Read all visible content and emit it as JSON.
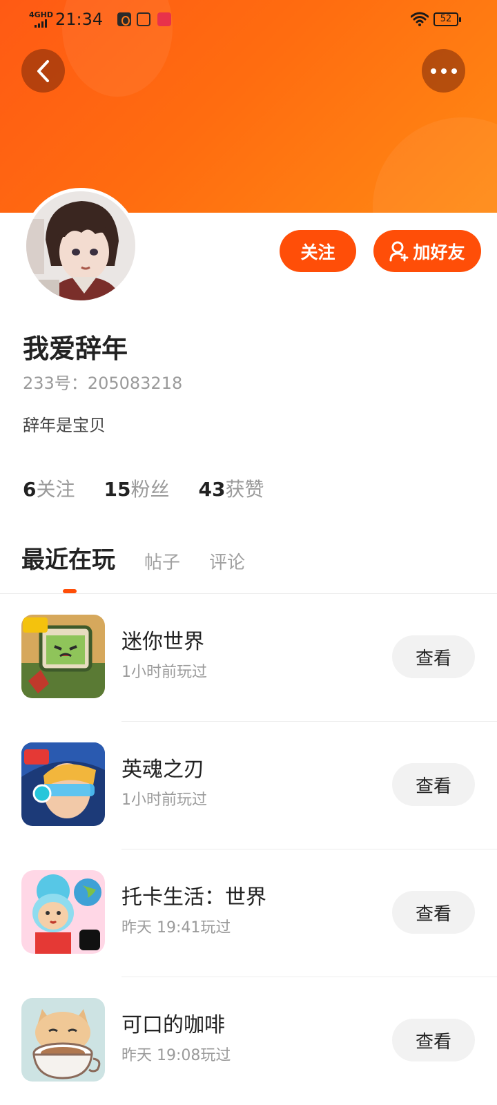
{
  "status_bar": {
    "network": "4GHD",
    "time": "21:34",
    "battery": "52"
  },
  "header": {
    "back_icon": "chevron-left-icon",
    "more_icon": "more-horizontal-icon"
  },
  "profile": {
    "username": "我爱辞年",
    "uid": "233号：205083218",
    "bio": "辞年是宝贝",
    "follow_label": "关注",
    "add_friend_label": "加好友",
    "stats": [
      {
        "num": "6",
        "label": "关注"
      },
      {
        "num": "15",
        "label": "粉丝"
      },
      {
        "num": "43",
        "label": "获赞"
      }
    ]
  },
  "tabs": [
    {
      "label": "最近在玩",
      "active": true
    },
    {
      "label": "帖子",
      "active": false
    },
    {
      "label": "评论",
      "active": false
    }
  ],
  "games": [
    {
      "name": "迷你世界",
      "time": "1小时前玩过",
      "button": "查看"
    },
    {
      "name": "英魂之刃",
      "time": "1小时前玩过",
      "button": "查看"
    },
    {
      "name": "托卡生活：世界",
      "time": "昨天 19:41玩过",
      "button": "查看"
    },
    {
      "name": "可口的咖啡",
      "time": "昨天 19:08玩过",
      "button": "查看"
    }
  ],
  "colors": {
    "accent": "#ff4e08",
    "header_start": "#ff5a14",
    "header_end": "#ff8a14"
  }
}
